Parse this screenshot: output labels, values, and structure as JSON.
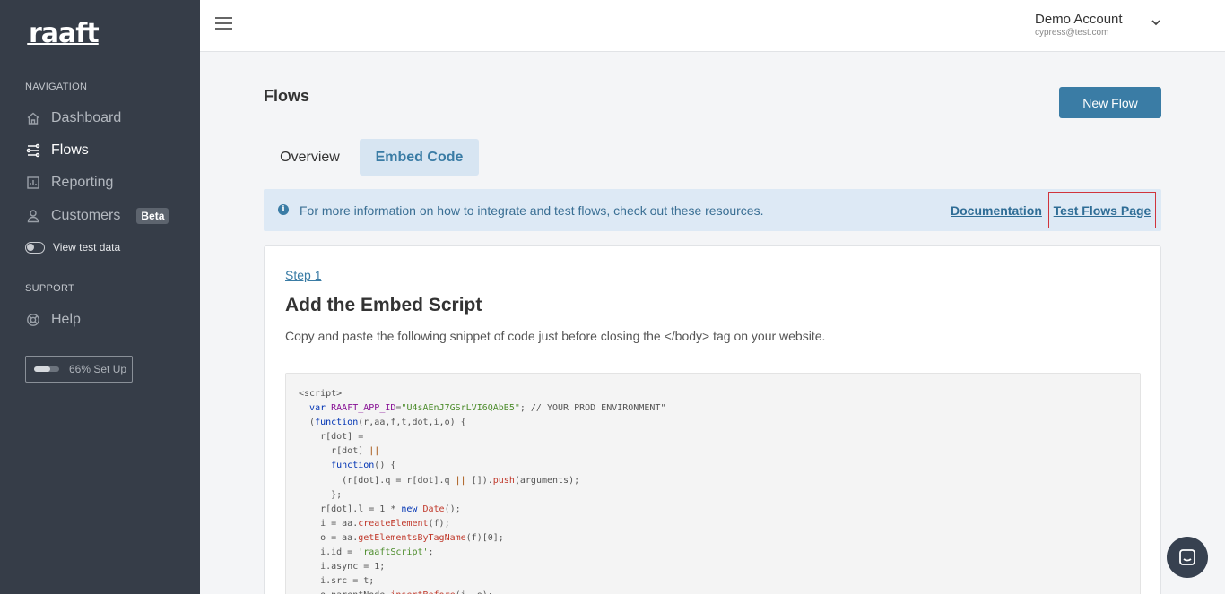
{
  "sidebar": {
    "logo": "raaft",
    "nav_title": "NAVIGATION",
    "items": [
      {
        "label": "Dashboard"
      },
      {
        "label": "Flows"
      },
      {
        "label": "Reporting"
      },
      {
        "label": "Customers",
        "badge": "Beta"
      }
    ],
    "toggle_label": "View test data",
    "support_title": "SUPPORT",
    "help_label": "Help",
    "setup_label": "66% Set Up",
    "setup_fraction": 0.66
  },
  "header": {
    "account_name": "Demo Account",
    "account_email": "cypress@test.com"
  },
  "main": {
    "title": "Flows",
    "new_flow_label": "New Flow",
    "tabs": [
      {
        "label": "Overview"
      },
      {
        "label": "Embed Code",
        "active": true
      }
    ],
    "info": {
      "text": "For more information on how to integrate and test flows, check out these resources.",
      "documentation_link": "Documentation",
      "test_flows_link": "Test Flows Page"
    },
    "step": {
      "link": "Step 1",
      "title": "Add the Embed Script",
      "description": "Copy and paste the following snippet of code just before closing the </body> tag on your website."
    },
    "code_lines": [
      "<script>",
      "  var RAAFT_APP_ID=\"U4sAEnJ7GSrLVI6QAbB5\"; // YOUR PROD ENVIRONMENT\"",
      "  (function(r,aa,f,t,dot,i,o) {",
      "    r[dot] =",
      "      r[dot] ||",
      "      function() {",
      "        (r[dot].q = r[dot].q || []).push(arguments);",
      "      };",
      "    r[dot].l = 1 * new Date();",
      "    i = aa.createElement(f);",
      "    o = aa.getElementsByTagName(f)[0];",
      "    i.id = 'raaftScript';",
      "    i.async = 1;",
      "    i.src = t;",
      "    o.parentNode.insertBefore(i, o);"
    ]
  },
  "colors": {
    "sidebar_bg": "#363d48",
    "accent": "#3a7ca5",
    "info_bg": "#dde9f5",
    "highlight_border": "#d0343c"
  }
}
